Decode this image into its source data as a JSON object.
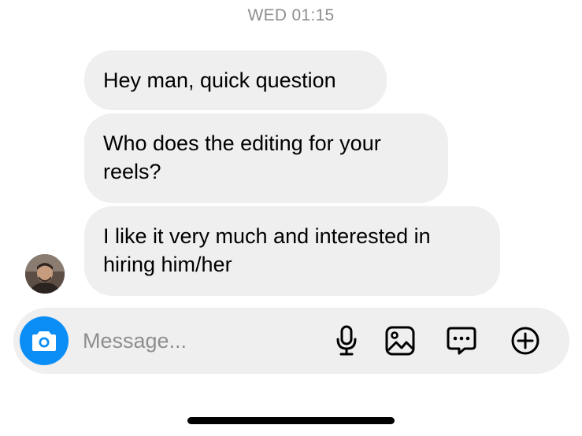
{
  "thread": {
    "timestamp": "WED 01:15",
    "messages": [
      {
        "lines": [
          "Hey man, quick question"
        ]
      },
      {
        "lines": [
          "Who does the editing for your",
          "reels?"
        ]
      },
      {
        "lines": [
          "I like it very much and interested in",
          "hiring him/her"
        ]
      }
    ]
  },
  "composer": {
    "placeholder": "Message...",
    "icons": [
      "camera-icon",
      "microphone-icon",
      "gallery-icon",
      "sticker-icon",
      "plus-icon"
    ]
  },
  "colors": {
    "accent": "#0a8ef5",
    "bubble": "#efefef",
    "muted_text": "#8e8e8e",
    "background": "#ffffff"
  }
}
